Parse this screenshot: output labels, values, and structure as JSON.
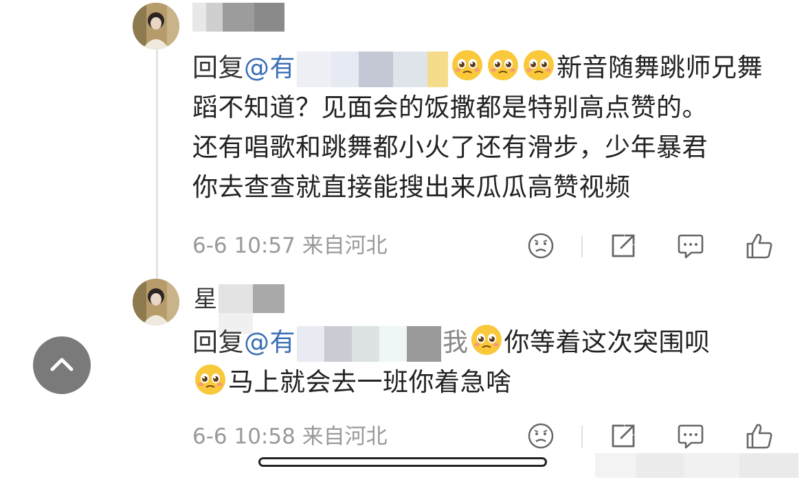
{
  "comments": [
    {
      "name_visible": "",
      "reply_prefix": "回复",
      "mention": "@有",
      "text_lines_after": "新音随舞跳师兄舞蹈不知道？见面会的饭撒都是特别高点赞的。还有唱歌和跳舞都小火了还有滑步，少年暴君你去查查就直接能搜出来瓜瓜高赞视频",
      "line1_tail": "新音随舞跳师兄舞",
      "line2": "蹈不知道？见面会的饭撒都是特别高点赞的。",
      "line3": "还有唱歌和跳舞都小火了还有滑步，少年暴君",
      "line4": "你去查查就直接能搜出来瓜瓜高赞视频",
      "date": "6-6 10:57",
      "location": "来自河北"
    },
    {
      "name_visible": "星",
      "reply_prefix": "回复",
      "mention": "@有",
      "masked_tail": "我",
      "line1_tail": "你等着这次突围呗",
      "line2": "马上就会去一班你着急啥",
      "date": "6-6 10:58",
      "location": "来自河北"
    }
  ],
  "icons": {
    "emoji": "pleading-face-emoji",
    "actions": [
      "dislike-face-icon",
      "share-icon",
      "comment-icon",
      "thumbs-up-icon"
    ],
    "scroll": "chevron-up-icon"
  },
  "colors": {
    "mention": "#3a6fb5",
    "meta": "#999999",
    "text": "#222222",
    "scroll_button": "#7a7a7a"
  }
}
